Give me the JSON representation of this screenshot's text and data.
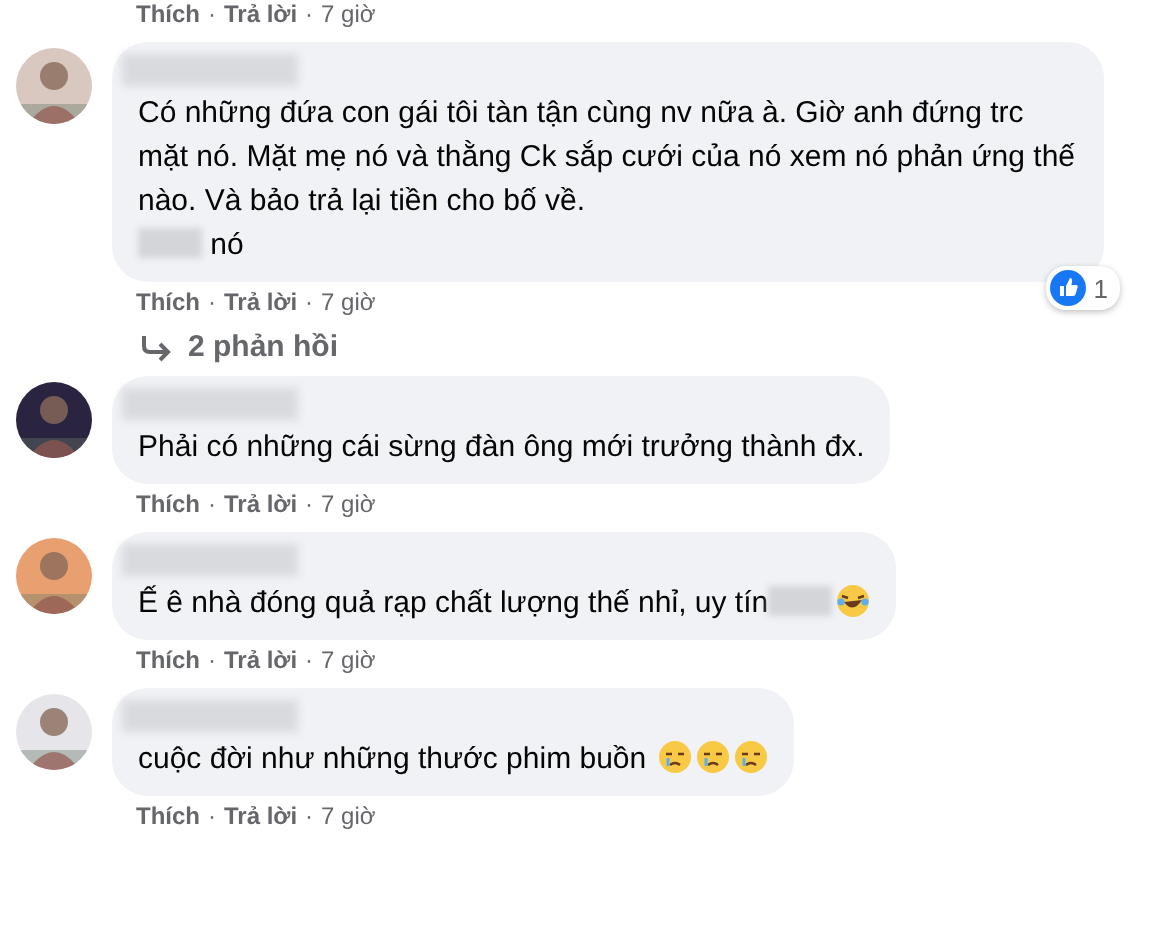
{
  "top_actions": [
    {
      "kind": "link",
      "text": "Thích"
    },
    {
      "kind": "sep",
      "text": "·"
    },
    {
      "kind": "link",
      "text": "Trả lời"
    },
    {
      "kind": "sep",
      "text": "·"
    },
    {
      "kind": "time",
      "text": "7 giờ"
    }
  ],
  "comments": [
    {
      "body": [
        {
          "kind": "text",
          "text": "Có những đứa con gái tôi tàn tận cùng nv nữa à. Giờ anh đứng trc mặt nó. Mặt mẹ nó và thằng Ck sắp cưới của nó xem nó phản ứng thế nào. Và bảo trả lại tiền cho bố về."
        },
        {
          "kind": "break"
        },
        {
          "kind": "blur"
        },
        {
          "kind": "text",
          "text": " nó"
        }
      ],
      "reaction_count": "1",
      "actions": [
        {
          "kind": "link",
          "text": "Thích"
        },
        {
          "kind": "sep",
          "text": "·"
        },
        {
          "kind": "link",
          "text": "Trả lời"
        },
        {
          "kind": "sep",
          "text": "·"
        },
        {
          "kind": "time",
          "text": "7 giờ"
        }
      ],
      "replies": "2 phản hồi"
    },
    {
      "body": [
        {
          "kind": "text",
          "text": "Phải có những cái sừng đàn ông mới trưởng thành đx."
        }
      ],
      "actions": [
        {
          "kind": "link",
          "text": "Thích"
        },
        {
          "kind": "sep",
          "text": "·"
        },
        {
          "kind": "link",
          "text": "Trả lời"
        },
        {
          "kind": "sep",
          "text": "·"
        },
        {
          "kind": "time",
          "text": "7 giờ"
        }
      ]
    },
    {
      "body": [
        {
          "kind": "text",
          "text": "Ế ê nhà đóng quả rạp chất lượng thế nhỉ, uy tín"
        },
        {
          "kind": "blur"
        },
        {
          "kind": "laughing_emoji"
        }
      ],
      "actions": [
        {
          "kind": "link",
          "text": "Thích"
        },
        {
          "kind": "sep",
          "text": "·"
        },
        {
          "kind": "link",
          "text": "Trả lời"
        },
        {
          "kind": "sep",
          "text": "·"
        },
        {
          "kind": "time",
          "text": "7 giờ"
        }
      ]
    },
    {
      "body": [
        {
          "kind": "text",
          "text": "cuộc đời như những thước phim buồn "
        },
        {
          "kind": "sad_emoji"
        },
        {
          "kind": "sad_emoji"
        },
        {
          "kind": "sad_emoji"
        }
      ],
      "actions": [
        {
          "kind": "link",
          "text": "Thích"
        },
        {
          "kind": "sep",
          "text": "·"
        },
        {
          "kind": "link",
          "text": "Trả lời"
        },
        {
          "kind": "sep",
          "text": "·"
        },
        {
          "kind": "time",
          "text": "7 giờ"
        }
      ]
    }
  ]
}
